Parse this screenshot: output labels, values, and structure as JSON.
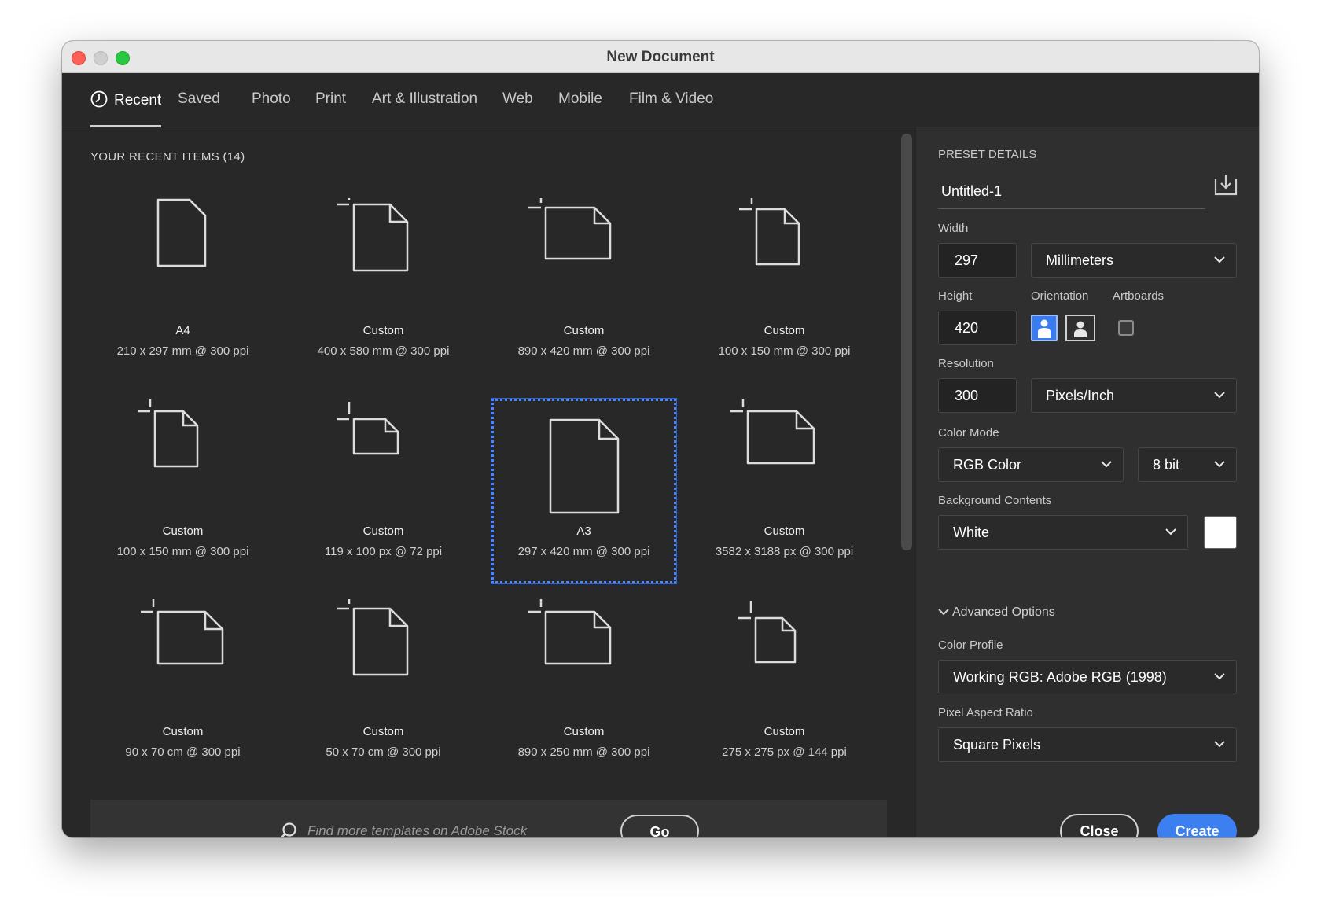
{
  "window": {
    "title": "New Document",
    "tabs": [
      {
        "label": "Recent",
        "active": true
      },
      {
        "label": "Saved"
      },
      {
        "label": "Photo"
      },
      {
        "label": "Print"
      },
      {
        "label": "Art & Illustration"
      },
      {
        "label": "Web"
      },
      {
        "label": "Mobile"
      },
      {
        "label": "Film & Video"
      }
    ]
  },
  "recent": {
    "heading": "YOUR RECENT ITEMS",
    "count": "(14)",
    "items": [
      {
        "name": "A4",
        "size": "210 x 297 mm @ 300 ppi",
        "icon": "document-portrait-icon"
      },
      {
        "name": "Custom",
        "size": "400 x 580 mm @ 300 ppi",
        "icon": "custom-portrait-icon"
      },
      {
        "name": "Custom",
        "size": "890 x 420 mm @ 300 ppi",
        "icon": "custom-landscape-icon"
      },
      {
        "name": "Custom",
        "size": "100 x 150 mm @ 300 ppi",
        "icon": "custom-portrait-icon"
      },
      {
        "name": "Custom",
        "size": "100 x 150 mm @ 300 ppi",
        "icon": "custom-portrait-icon"
      },
      {
        "name": "Custom",
        "size": "119 x 100 px @ 72 ppi",
        "icon": "custom-landscape-icon"
      },
      {
        "name": "A3",
        "size": "297 x 420 mm @ 300 ppi",
        "icon": "document-portrait-icon",
        "selected": true
      },
      {
        "name": "Custom",
        "size": "3582 x 3188 px @ 300 ppi",
        "icon": "custom-landscape-icon"
      },
      {
        "name": "Custom",
        "size": "90 x 70 cm @ 300 ppi",
        "icon": "custom-landscape-icon"
      },
      {
        "name": "Custom",
        "size": "50 x 70 cm @ 300 ppi",
        "icon": "custom-portrait-icon"
      },
      {
        "name": "Custom",
        "size": "890 x 250 mm @ 300 ppi",
        "icon": "custom-landscape-icon"
      },
      {
        "name": "Custom",
        "size": "275 x 275 px @ 144 ppi",
        "icon": "custom-square-icon"
      }
    ]
  },
  "search": {
    "placeholder": "Find more templates on Adobe Stock",
    "go_label": "Go"
  },
  "preset": {
    "heading": "PRESET DETAILS",
    "name": "Untitled-1",
    "width_label": "Width",
    "width_value": "297",
    "width_unit": "Millimeters",
    "height_label": "Height",
    "height_value": "420",
    "orientation_label": "Orientation",
    "orientation": "portrait",
    "artboards_label": "Artboards",
    "artboards_checked": false,
    "resolution_label": "Resolution",
    "resolution_value": "300",
    "resolution_unit": "Pixels/Inch",
    "color_mode_label": "Color Mode",
    "color_mode": "RGB Color",
    "bit_depth": "8 bit",
    "background_label": "Background Contents",
    "background": "White",
    "background_swatch_color": "#ffffff",
    "advanced_label": "Advanced Options",
    "color_profile_label": "Color Profile",
    "color_profile": "Working RGB: Adobe RGB (1998)",
    "pixel_aspect_label": "Pixel Aspect Ratio",
    "pixel_aspect": "Square Pixels"
  },
  "actions": {
    "close_label": "Close",
    "create_label": "Create"
  },
  "colors": {
    "accent": "#3c7ff0",
    "dialog_bg": "#282828",
    "panel_bg": "#2f2f2f"
  }
}
